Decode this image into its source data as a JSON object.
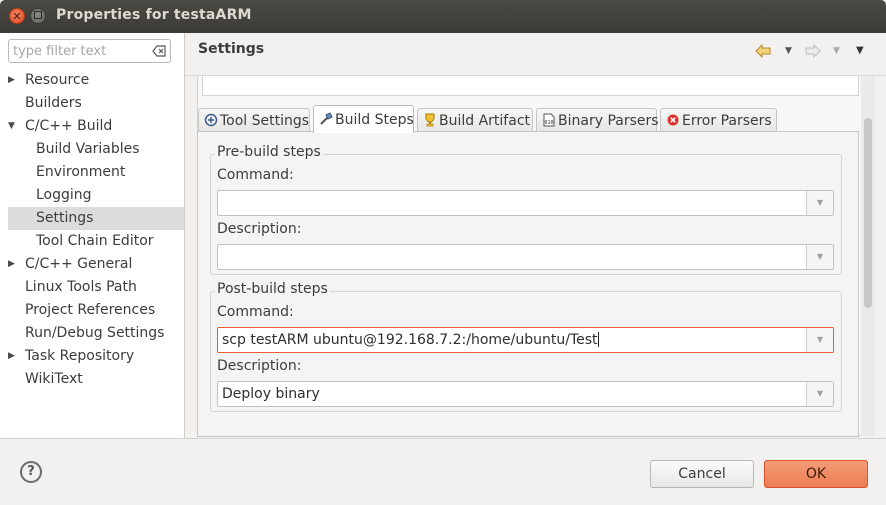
{
  "window": {
    "title": "Properties for testaARM"
  },
  "filter": {
    "placeholder": "type filter text",
    "value": ""
  },
  "tree": [
    {
      "label": "Resource",
      "expandable": true,
      "level": 0
    },
    {
      "label": "Builders",
      "expandable": false,
      "level": 0
    },
    {
      "label": "C/C++ Build",
      "expandable": true,
      "expanded": true,
      "level": 0
    },
    {
      "label": "Build Variables",
      "level": 1
    },
    {
      "label": "Environment",
      "level": 1
    },
    {
      "label": "Logging",
      "level": 1
    },
    {
      "label": "Settings",
      "level": 1,
      "selected": true
    },
    {
      "label": "Tool Chain Editor",
      "level": 1
    },
    {
      "label": "C/C++ General",
      "expandable": true,
      "level": 0
    },
    {
      "label": "Linux Tools Path",
      "level": 0
    },
    {
      "label": "Project References",
      "level": 0
    },
    {
      "label": "Run/Debug Settings",
      "level": 0
    },
    {
      "label": "Task Repository",
      "expandable": true,
      "level": 0
    },
    {
      "label": "WikiText",
      "level": 0
    }
  ],
  "page": {
    "heading": "Settings"
  },
  "tabs": [
    {
      "label": "Tool Settings",
      "icon": "tool-settings-icon"
    },
    {
      "label": "Build Steps",
      "icon": "build-steps-icon",
      "active": true
    },
    {
      "label": "Build Artifact",
      "icon": "build-artifact-icon"
    },
    {
      "label": "Binary Parsers",
      "icon": "binary-parsers-icon"
    },
    {
      "label": "Error Parsers",
      "icon": "error-parsers-icon"
    }
  ],
  "prebuild": {
    "title": "Pre-build steps",
    "command_label": "Command:",
    "command_value": "",
    "description_label": "Description:",
    "description_value": ""
  },
  "postbuild": {
    "title": "Post-build steps",
    "command_label": "Command:",
    "command_value": "scp testARM ubuntu@192.168.7.2:/home/ubuntu/Test",
    "description_label": "Description:",
    "description_value": "Deploy binary"
  },
  "buttons": {
    "cancel": "Cancel",
    "ok": "OK",
    "help": "?"
  },
  "colors": {
    "accent": "#ec7e55",
    "focus": "#e95b2b",
    "titlebar": "#3c3b37"
  }
}
